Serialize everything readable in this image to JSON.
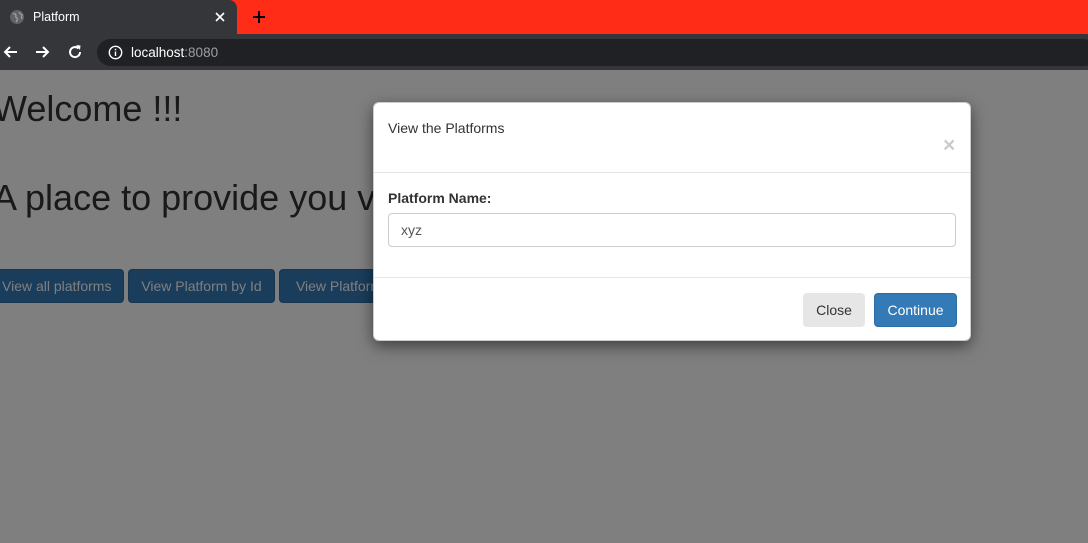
{
  "browser": {
    "tab_title": "Platform",
    "new_tab_symbol": "+",
    "url_host": "localhost",
    "url_port": ":8080",
    "colors": {
      "tabbar_bg": "#ff2d17",
      "chrome_bg": "#35363a"
    }
  },
  "page": {
    "welcome": "Welcome !!!",
    "tagline": "A place to provide you v",
    "buttons": [
      {
        "label": "View all platforms"
      },
      {
        "label": "View Platform by Id"
      },
      {
        "label": "View Platform"
      }
    ]
  },
  "modal": {
    "title": "View the Platforms",
    "close_x": "×",
    "field_label": "Platform Name:",
    "field_value": "xyz",
    "close_button": "Close",
    "continue_button": "Continue",
    "colors": {
      "primary": "#337ab7",
      "default": "#e6e6e6"
    }
  }
}
